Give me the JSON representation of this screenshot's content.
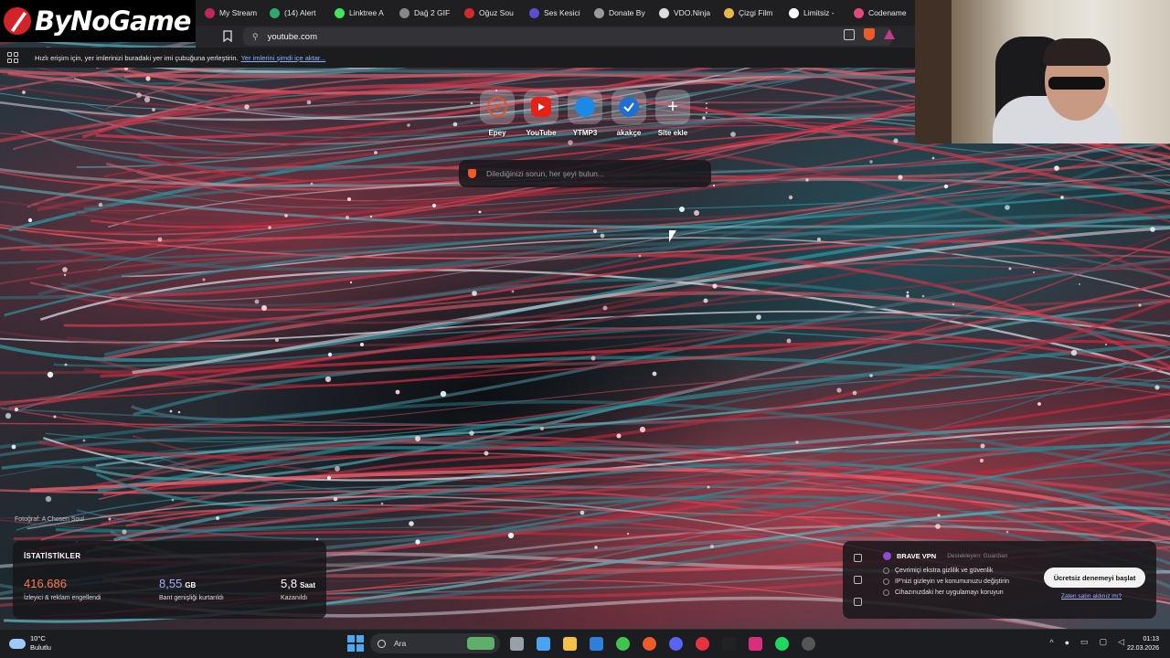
{
  "logo": {
    "text": "ByNoGame"
  },
  "tabs": [
    {
      "label": "My Stream",
      "icon": "stream-icon",
      "color": "#c0265a"
    },
    {
      "label": "(14) Alert",
      "icon": "alert-icon",
      "color": "#2ea86b"
    },
    {
      "label": "Linktree A",
      "icon": "linktree-icon",
      "color": "#43e55e"
    },
    {
      "label": "Dağ 2 GIF",
      "icon": "gif-icon",
      "color": "#888888"
    },
    {
      "label": "Oğuz Sou",
      "icon": "sound-icon",
      "color": "#d12a2a"
    },
    {
      "label": "Ses Kesici",
      "icon": "cutter-icon",
      "color": "#5c4ccf"
    },
    {
      "label": "Donate By",
      "icon": "donate-icon",
      "color": "#9a9a9a"
    },
    {
      "label": "VDO.Ninja",
      "icon": "ninja-icon",
      "color": "#dddddd"
    },
    {
      "label": "Çizgi Film",
      "icon": "cartoon-icon",
      "color": "#e8b84a"
    },
    {
      "label": "Limitsiz -",
      "icon": "limit-icon",
      "color": "#ffffff"
    },
    {
      "label": "Codename",
      "icon": "codename-icon",
      "color": "#e04a7a"
    }
  ],
  "address": {
    "url": "youtube.com"
  },
  "bookmarks_bar": {
    "text": "Hızlı erişim için, yer imlerinizi buradaki yer imi çubuğuna yerleştirin.",
    "link": "Yer imlerini şimdi içe aktar..."
  },
  "top_sites": [
    {
      "label": "Epey",
      "icon": "epey-icon",
      "color": "#e8502a"
    },
    {
      "label": "YouTube",
      "icon": "youtube-icon",
      "color": "#e62117"
    },
    {
      "label": "YTMP3",
      "icon": "ytmp3-icon",
      "color": "#1e88e5"
    },
    {
      "label": "akakçe",
      "icon": "akakce-icon",
      "color": "#1f6fd1"
    },
    {
      "label": "Site ekle",
      "icon": "plus-icon",
      "color": "transparent"
    }
  ],
  "search": {
    "placeholder": "Dilediğinizi sorun, her şeyi bulun..."
  },
  "photo_credit": "Fotoğraf: A Chosen Soul",
  "stats": {
    "title": "İSTATİSTİKLER",
    "items": [
      {
        "value": "416.686",
        "unit": "",
        "desc": "İzleyici & reklam engellendi",
        "color": "#ff7a4d"
      },
      {
        "value": "8,55",
        "unit": "GB",
        "desc": "Bant genişliği kurtarıldı",
        "color": "#9db5ff"
      },
      {
        "value": "5,8",
        "unit": "Saat",
        "desc": "Kazanıldı",
        "color": "#ffffff"
      }
    ]
  },
  "vpn": {
    "name": "BRAVE VPN",
    "sponsor": "Destekleyen: Guardian",
    "features": [
      "Çevrimiçi ekstra gizlilik ve güvenlik",
      "IP'nizi gizleyin ve konumunuzu değiştirin",
      "Cihazınızdaki her uygulamayı koruyun"
    ],
    "cta": "Ücretsiz denemeyi başlat",
    "link": "Zaten satın aldınız mı?"
  },
  "taskbar": {
    "weather_temp": "10°C",
    "weather_desc": "Bulutlu",
    "search": "Ara",
    "apps": [
      {
        "name": "file-manager-icon",
        "color": "#9aa0a8"
      },
      {
        "name": "store-icon",
        "color": "#4aa3f0"
      },
      {
        "name": "folder-icon",
        "color": "#f3c24b"
      },
      {
        "name": "mail-icon",
        "color": "#2f7fd8"
      },
      {
        "name": "whatsapp-icon",
        "color": "#3fc351"
      },
      {
        "name": "brave-icon",
        "color": "#f05a28"
      },
      {
        "name": "discord-icon",
        "color": "#5865f2"
      },
      {
        "name": "app-red-icon",
        "color": "#e2333f"
      },
      {
        "name": "tiktok-icon",
        "color": "#222222"
      },
      {
        "name": "instagram-icon",
        "color": "#d6307d"
      },
      {
        "name": "spotify-icon",
        "color": "#1ed760"
      },
      {
        "name": "obs-icon",
        "color": "#555555"
      }
    ],
    "time": "01:13",
    "date": "22.03.2026"
  }
}
